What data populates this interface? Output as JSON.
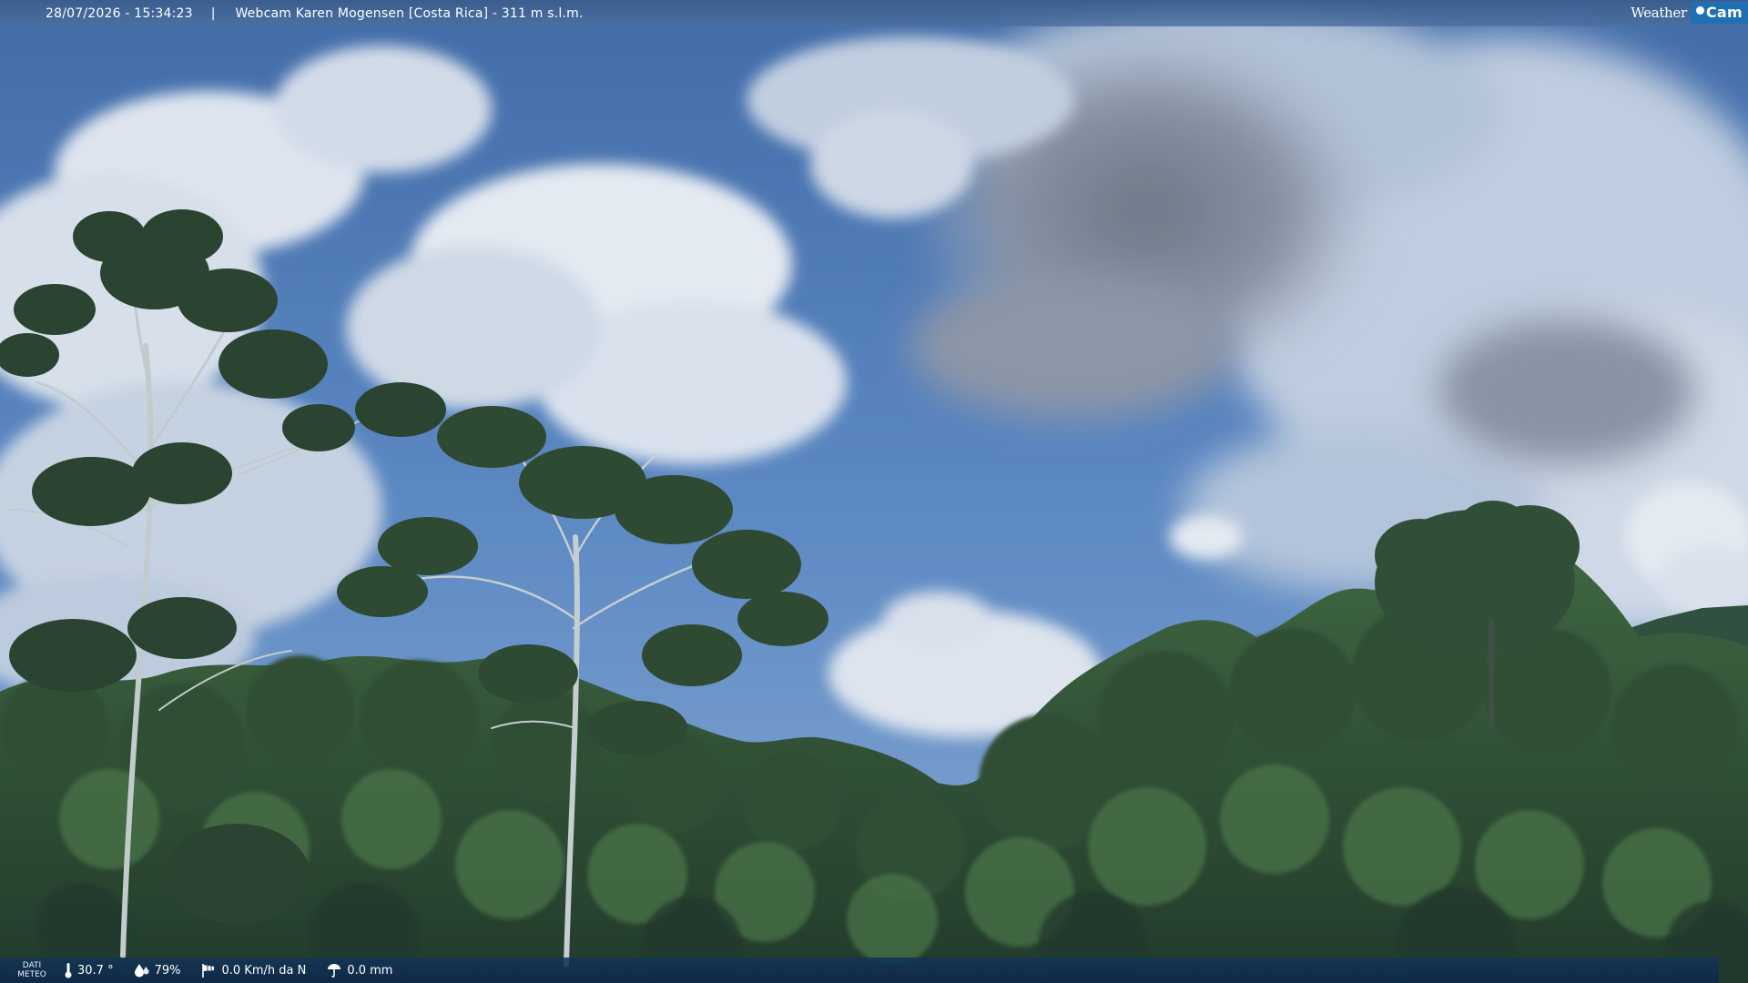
{
  "header": {
    "timestamp": "28/07/2026 - 15:34:23",
    "separator": "|",
    "title": "Webcam Karen Mogensen [Costa Rica]  - 311 m s.l.m."
  },
  "logo": {
    "left": "Weather",
    "right": "Cam"
  },
  "footer": {
    "label_line1": "DATI",
    "label_line2": "METEO",
    "temperature": "30.7 °",
    "humidity": "79%",
    "wind": "0.0 Km/h da N",
    "rain": "0.0 mm"
  },
  "icons": {
    "temperature": "thermometer-icon",
    "humidity": "drop-icon",
    "wind": "windsock-icon",
    "rain": "rain-gauge-icon"
  },
  "colors": {
    "sky": "#4a78b8",
    "cloud": "#dde4ee",
    "dark_cloud": "#7f8796",
    "forest_dark": "#1f3a22",
    "forest_mid": "#2f5530",
    "brand_blue": "#1f6fb5"
  }
}
